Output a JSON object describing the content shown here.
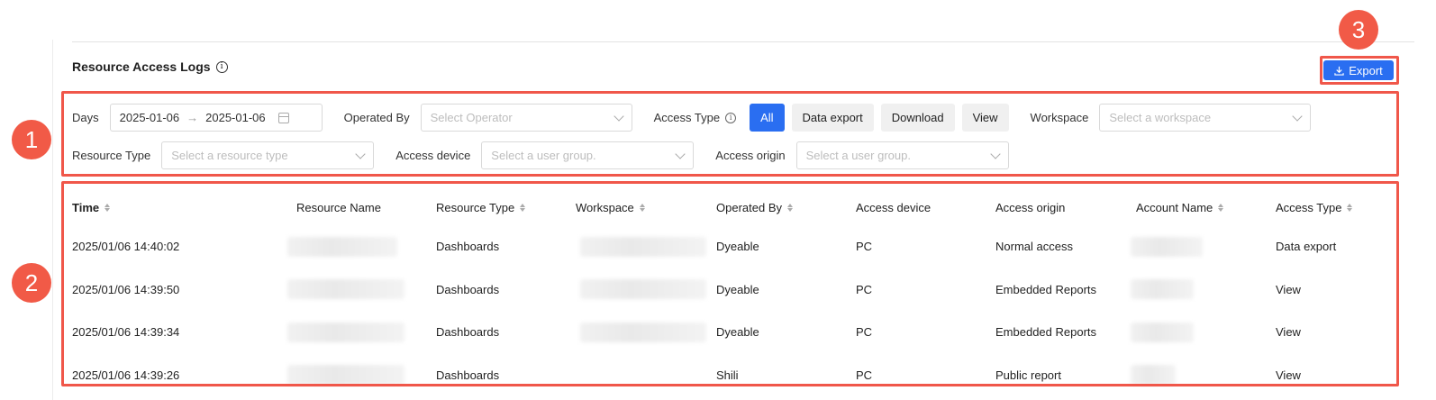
{
  "header": {
    "title": "Resource Access Logs",
    "export_label": "Export"
  },
  "filters": {
    "days_label": "Days",
    "date_start": "2025-01-06",
    "date_end": "2025-01-06",
    "date_separator": "→",
    "operated_by_label": "Operated By",
    "operated_by_placeholder": "Select Operator",
    "access_type_label": "Access Type",
    "access_type_options": [
      "All",
      "Data export",
      "Download",
      "View"
    ],
    "access_type_selected": "All",
    "workspace_label": "Workspace",
    "workspace_placeholder": "Select a workspace",
    "resource_type_label": "Resource Type",
    "resource_type_placeholder": "Select a resource type",
    "access_device_label": "Access device",
    "access_device_placeholder": "Select a user group.",
    "access_origin_label": "Access origin",
    "access_origin_placeholder": "Select a user group."
  },
  "table": {
    "columns": [
      "Time",
      "Resource Name",
      "Resource Type",
      "Workspace",
      "Operated By",
      "Access device",
      "Access origin",
      "Account Name",
      "Access Type"
    ],
    "rows": [
      {
        "time": "2025/01/06 14:40:02",
        "resource_type": "Dashboards",
        "operated_by": "Dyeable",
        "device": "PC",
        "origin": "Normal access",
        "access_type": "Data export"
      },
      {
        "time": "2025/01/06 14:39:50",
        "resource_type": "Dashboards",
        "operated_by": "Dyeable",
        "device": "PC",
        "origin": "Embedded Reports",
        "access_type": "View"
      },
      {
        "time": "2025/01/06 14:39:34",
        "resource_type": "Dashboards",
        "operated_by": "Dyeable",
        "device": "PC",
        "origin": "Embedded Reports",
        "access_type": "View"
      },
      {
        "time": "2025/01/06 14:39:26",
        "resource_type": "Dashboards",
        "operated_by": "Shili",
        "device": "PC",
        "origin": "Public report",
        "access_type": "View"
      }
    ]
  },
  "annotations": {
    "badge_1": "1",
    "badge_2": "2",
    "badge_3": "3"
  },
  "colors": {
    "accent": "#2a6ef1",
    "highlight": "#f0574a"
  }
}
